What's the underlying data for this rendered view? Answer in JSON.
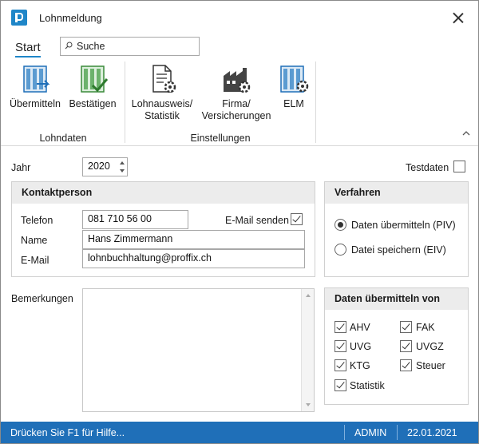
{
  "window": {
    "title": "Lohnmeldung"
  },
  "ribbon": {
    "tab": "Start",
    "search_placeholder": "Suche",
    "groups": [
      {
        "label": "Lohndaten",
        "buttons": [
          "Übermitteln",
          "Bestätigen"
        ]
      },
      {
        "label": "Einstellungen",
        "buttons": [
          "Lohnausweis/\nStatistik",
          "Firma/\nVersicherungen",
          "ELM"
        ]
      }
    ],
    "btn_uebermitteln": "Übermitteln",
    "btn_bestaetigen": "Bestätigen",
    "btn_lohnausweis_1": "Lohnausweis/",
    "btn_lohnausweis_2": "Statistik",
    "btn_firma_1": "Firma/",
    "btn_firma_2": "Versicherungen",
    "btn_elm": "ELM",
    "group_lohndaten": "Lohndaten",
    "group_einstellungen": "Einstellungen"
  },
  "form": {
    "jahr_label": "Jahr",
    "jahr_value": "2020",
    "testdaten_label": "Testdaten",
    "testdaten_checked": false,
    "kontakt": {
      "header": "Kontaktperson",
      "telefon_label": "Telefon",
      "telefon_value": "081 710 56 00",
      "email_senden_label": "E-Mail senden",
      "email_senden_checked": true,
      "name_label": "Name",
      "name_value": "Hans Zimmermann",
      "email_label": "E-Mail",
      "email_value": "lohnbuchhaltung@proffix.ch"
    },
    "verfahren": {
      "header": "Verfahren",
      "option1": "Daten übermitteln (PIV)",
      "option2": "Datei speichern (EIV)",
      "selected": "option1"
    },
    "bemerkungen_label": "Bemerkungen",
    "bemerkungen_value": "",
    "daten_von": {
      "header": "Daten übermitteln von",
      "items": [
        {
          "label": "AHV",
          "checked": true
        },
        {
          "label": "FAK",
          "checked": true
        },
        {
          "label": "UVG",
          "checked": true
        },
        {
          "label": "UVGZ",
          "checked": true
        },
        {
          "label": "KTG",
          "checked": true
        },
        {
          "label": "Steuer",
          "checked": true
        },
        {
          "label": "Statistik",
          "checked": true
        }
      ]
    }
  },
  "statusbar": {
    "help": "Drücken Sie F1 für Hilfe...",
    "user": "ADMIN",
    "date": "22.01.2021"
  },
  "colors": {
    "accent": "#1f86c8",
    "statusbar": "#1f6fb8",
    "group_header": "#ececec"
  }
}
